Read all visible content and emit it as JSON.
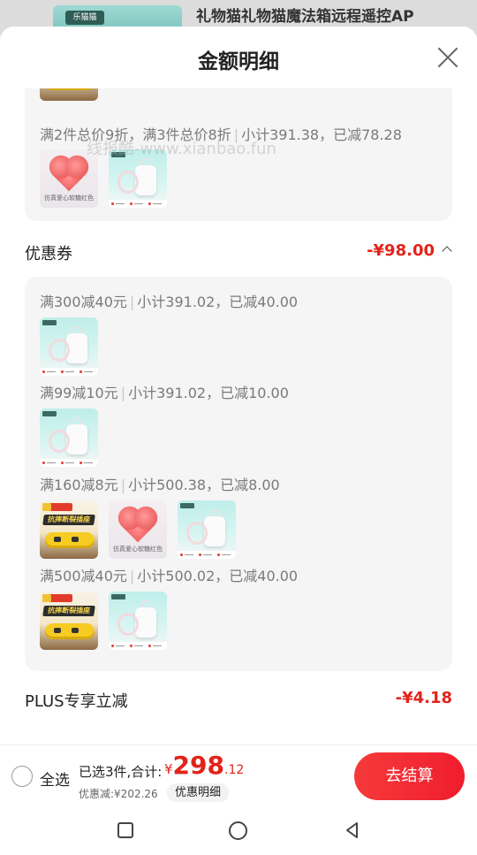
{
  "background": {
    "title": "礼物猫礼物猫魔法箱远程遥控AP",
    "thumb_label": "乐猫猫"
  },
  "sheet": {
    "title": "金额明细"
  },
  "watermark": "线报酷-www.xianbao.fun",
  "promo_card": {
    "rule": "满2件总价9折，满3件总价8折",
    "sep": "|",
    "subtotal": "小计391.38，已减78.28"
  },
  "coupon_section": {
    "label": "优惠券",
    "amount": "-¥98.00",
    "rules": [
      {
        "rule": "满300减40元",
        "subtotal": "小计391.02，已减40.00"
      },
      {
        "rule": "满99减10元",
        "subtotal": "小计391.02，已减10.00"
      },
      {
        "rule": "满160减8元",
        "subtotal": "小计500.38，已减8.00"
      },
      {
        "rule": "满500减40元",
        "subtotal": "小计500.02，已减40.00"
      }
    ]
  },
  "plus_section": {
    "label": "PLUS专享立减",
    "amount": "-¥4.18"
  },
  "product_texts": {
    "strip_headline": "抗摔断裂插座",
    "heart_caption": "仿真爱心软糖红色"
  },
  "footer": {
    "select_all": "全选",
    "summary": "已选3件,合计:",
    "price_symbol": "¥",
    "price_int": "298",
    "price_dec": ".12",
    "discount": "优惠减:¥202.26",
    "detail_button": "优惠明细",
    "checkout": "去结算"
  },
  "colors": {
    "accent": "#e2231a",
    "checkout_bg": "#f32d34"
  }
}
